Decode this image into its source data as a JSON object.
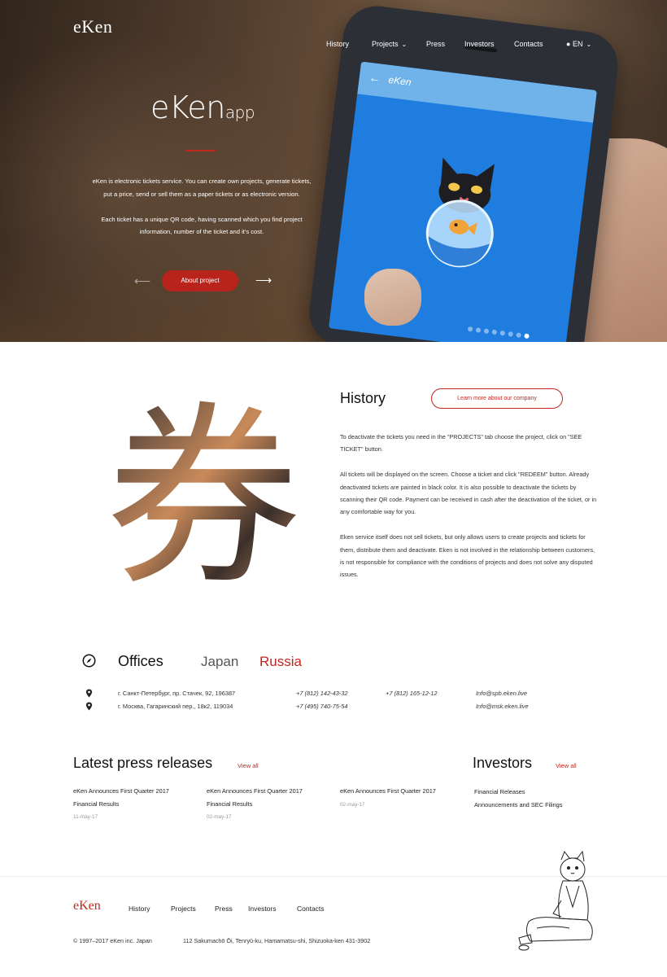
{
  "nav": {
    "logo": "eKen",
    "items": [
      "History",
      "Projects",
      "Press",
      "Investors",
      "Contacts"
    ],
    "lang": "EN"
  },
  "phone": {
    "app_title": "eKen"
  },
  "hero": {
    "title": "eKen",
    "title_suffix": "app",
    "description": [
      "eKen is electronic tickets service. You can create own projects, generate tickets, put a price, send or sell them as a paper tickets or as electronic version.",
      "Each ticket has a unique QR code, having scanned which you find project information, number of the ticket and it's cost."
    ],
    "button": "About project"
  },
  "history": {
    "title": "History",
    "button": "Learn more about our company",
    "kanji": "券",
    "paragraphs": [
      "To deactivate the tickets you need in the \"PROJECTS\" tab choose the project, click on \"SEE TICKET\" button.",
      "All tickets will be displayed on the screen. Choose a ticket and click \"REDEEM\" button. Already deactivated tickets are painted in black color. It is also possible to deactivate the tickets by scanning their QR code. Payment can be received in cash after the deactivation of the ticket, or in any comfortable way for you.",
      "Eken service itself does not sell tickets, but only allows users to create projects and tickets for them, distribute them and deactivate. Eken is not involved in the relationship between customers, is not responsible for compliance with the conditions of projects and does not solve any disputed issues."
    ]
  },
  "offices": {
    "title": "Offices",
    "tabs": [
      "Japan",
      "Russia"
    ],
    "active_tab": "Russia",
    "rows": [
      {
        "address": "г. Санкт-Петербург, пр. Стачек, 92, 196387",
        "phone1": "+7 (812) 142-43-32",
        "phone2": "+7 (812) 165-12-12",
        "email": "Info@spb.eken.live"
      },
      {
        "address": "г. Москва, Гагаринский пер., 18к2, 119034",
        "phone1": "+7 (495) 740-75-54",
        "phone2": "",
        "email": "Info@msk.eken.live"
      }
    ]
  },
  "press": {
    "title": "Latest press releases",
    "view_all": "View all",
    "items": [
      {
        "title": "eKen Announces First Quarter 2017 Financial Results",
        "date": "11-may-17"
      },
      {
        "title": "eKen Announces First Quarter 2017 Financial Results",
        "date": "02-may-17"
      },
      {
        "title": "eKen Announces First Quarter 2017",
        "date": "02-may-17"
      }
    ]
  },
  "investors": {
    "title": "Investors",
    "view_all": "View all",
    "links": [
      "Financial Releases",
      "Announcements and SEC Filings"
    ]
  },
  "footer": {
    "logo": "eKen",
    "nav": [
      "History",
      "Projects",
      "Press",
      "Investors",
      "Contacts"
    ],
    "copyright": "© 1997–2017 eKen inc. Japan",
    "address": "112 Sakumachō Ōi, Tenryū-ku, Hamamatsu-shi, Shizuoka-ken 431-3902"
  },
  "colors": {
    "accent": "#c0281e",
    "phone_screen": "#1f7de0"
  }
}
